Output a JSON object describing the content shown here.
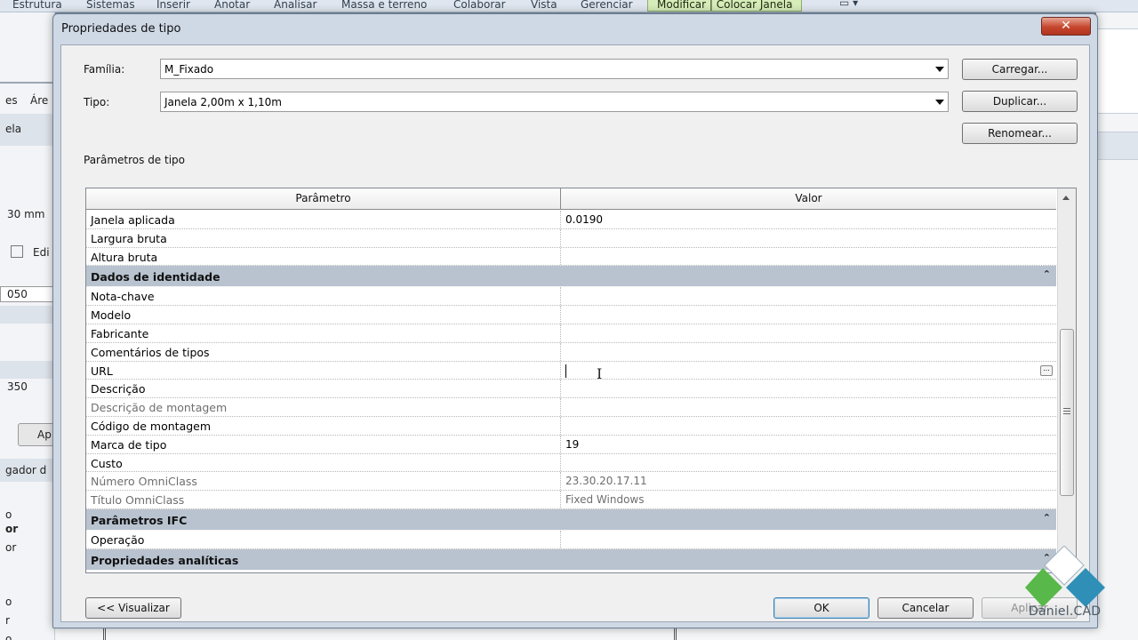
{
  "ribbon": {
    "tabs": [
      "Estrutura",
      "Sistemas",
      "Inserir",
      "Anotar",
      "Analisar",
      "Massa e terreno",
      "Colaborar",
      "Vista",
      "Gerenciar",
      "Modificar | Colocar Janela"
    ]
  },
  "background": {
    "left_texts": [
      "es",
      "Áre",
      "ela",
      "30 mm",
      "Edi",
      "050",
      "350",
      "Ap",
      "gador d",
      "o",
      "or",
      "or",
      "o",
      "r",
      "o"
    ]
  },
  "dialog": {
    "title": "Propriedades de tipo",
    "close_label": "✕",
    "family_label": "Família:",
    "family_value": "M_Fixado",
    "type_label": "Tipo:",
    "type_value": "Janela 2,00m x 1,10m",
    "load_button": "Carregar...",
    "duplicate_button": "Duplicar...",
    "rename_button": "Renomear...",
    "params_section_label": "Parâmetros de tipo",
    "grid": {
      "col_param": "Parâmetro",
      "col_value": "Valor",
      "rows": [
        {
          "kind": "row",
          "param": "Janela aplicada",
          "value": "0.0190"
        },
        {
          "kind": "row",
          "param": "Largura bruta",
          "value": ""
        },
        {
          "kind": "row",
          "param": "Altura bruta",
          "value": ""
        },
        {
          "kind": "group",
          "param": "Dados de identidade",
          "value": "⌃"
        },
        {
          "kind": "row",
          "param": "Nota-chave",
          "value": ""
        },
        {
          "kind": "row",
          "param": "Modelo",
          "value": ""
        },
        {
          "kind": "row",
          "param": "Fabricante",
          "value": ""
        },
        {
          "kind": "row",
          "param": "Comentários de tipos",
          "value": ""
        },
        {
          "kind": "row",
          "param": "URL",
          "value": ""
        },
        {
          "kind": "row",
          "param": "Descrição",
          "value": ""
        },
        {
          "kind": "ro",
          "param": "Descrição de montagem",
          "value": ""
        },
        {
          "kind": "row",
          "param": "Código de montagem",
          "value": ""
        },
        {
          "kind": "row",
          "param": "Marca de tipo",
          "value": "19"
        },
        {
          "kind": "row",
          "param": "Custo",
          "value": ""
        },
        {
          "kind": "ro",
          "param": "Número OmniClass",
          "value": "23.30.20.17.11"
        },
        {
          "kind": "ro",
          "param": "Título OmniClass",
          "value": "Fixed Windows"
        },
        {
          "kind": "group",
          "param": "Parâmetros IFC",
          "value": "⌃"
        },
        {
          "kind": "row",
          "param": "Operação",
          "value": ""
        },
        {
          "kind": "group",
          "param": "Propriedades analíticas",
          "value": "⌃"
        }
      ]
    },
    "preview_button": "<< Visualizar",
    "ok_button": "OK",
    "cancel_button": "Cancelar",
    "apply_button": "Aplicar"
  },
  "watermark": {
    "text": "Daniel.CAD",
    "colors": {
      "top": "#ffffff",
      "left": "#58b84a",
      "right": "#2f8fb7"
    }
  }
}
